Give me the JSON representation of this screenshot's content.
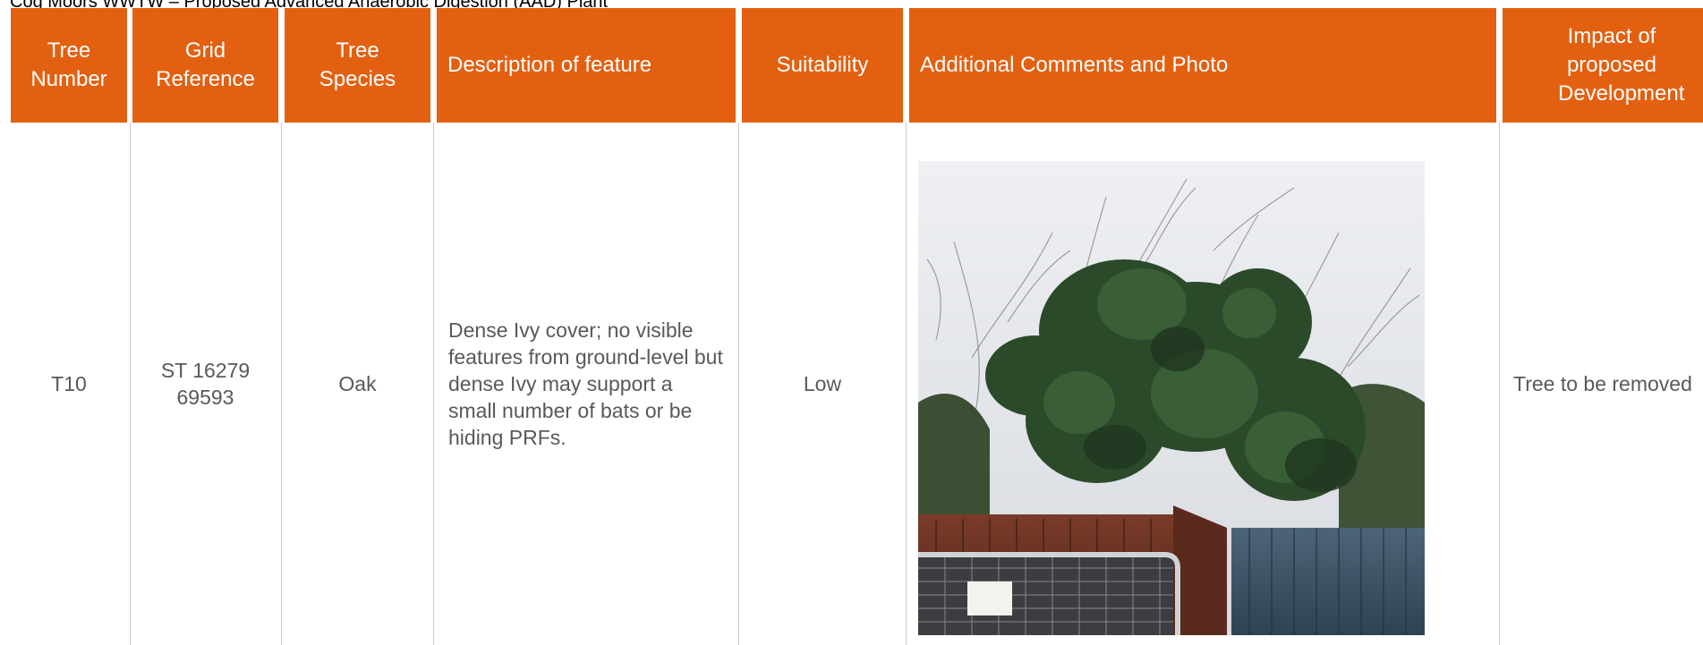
{
  "document": {
    "title": "Cog Moors WWTW – Proposed Advanced Anaerobic Digestion (AAD) Plant"
  },
  "table": {
    "headers": {
      "tree_number": [
        "Tree",
        "Number"
      ],
      "grid_reference": [
        "Grid",
        "Reference"
      ],
      "tree_species": [
        "Tree",
        "Species"
      ],
      "description": "Description of feature",
      "suitability": "Suitability",
      "comments": "Additional Comments and Photo",
      "impact": [
        "Impact of",
        "proposed",
        "Development"
      ]
    },
    "row": {
      "tree_number": "T10",
      "grid_reference": [
        "ST 16279",
        "69593"
      ],
      "tree_species": "Oak",
      "description": "Dense Ivy cover; no visible features from ground-level but dense Ivy may support a small number of bats or be hiding PRFs.",
      "suitability": "Low",
      "impact": "Tree to be removed"
    }
  },
  "colors": {
    "header_bg": "#e36011",
    "header_text": "#ffffff",
    "body_text": "#595959",
    "divider": "#c9c9c9"
  }
}
